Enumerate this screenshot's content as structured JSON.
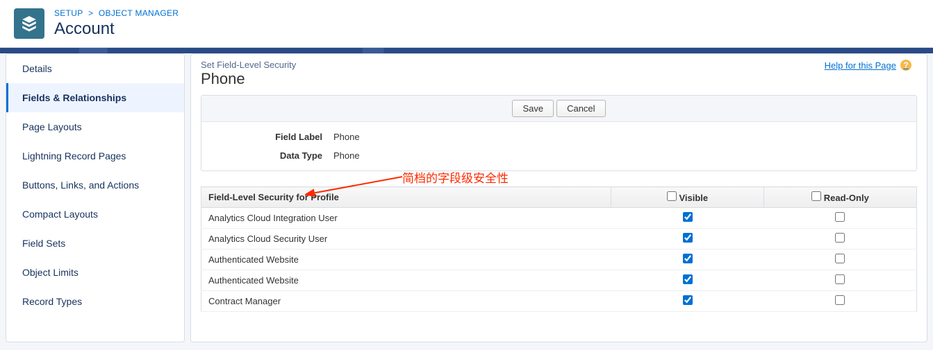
{
  "breadcrumb": {
    "setup": "SETUP",
    "sep": ">",
    "om": "OBJECT MANAGER"
  },
  "page_title": "Account",
  "help_label": "Help for this Page",
  "sidebar": {
    "items": [
      {
        "label": "Details"
      },
      {
        "label": "Fields & Relationships"
      },
      {
        "label": "Page Layouts"
      },
      {
        "label": "Lightning Record Pages"
      },
      {
        "label": "Buttons, Links, and Actions"
      },
      {
        "label": "Compact Layouts"
      },
      {
        "label": "Field Sets"
      },
      {
        "label": "Object Limits"
      },
      {
        "label": "Record Types"
      }
    ],
    "active_index": 1
  },
  "main": {
    "subtitle": "Set Field-Level Security",
    "title": "Phone",
    "buttons": {
      "save": "Save",
      "cancel": "Cancel"
    },
    "fields": {
      "label_label": "Field Label",
      "label_value": "Phone",
      "type_label": "Data Type",
      "type_value": "Phone"
    },
    "annotation": "简档的字段级安全性",
    "table": {
      "header": {
        "profile": "Field-Level Security for Profile",
        "visible": "Visible",
        "readonly": "Read-Only"
      },
      "rows": [
        {
          "profile": "Analytics Cloud Integration User",
          "visible": true,
          "readonly": false
        },
        {
          "profile": "Analytics Cloud Security User",
          "visible": true,
          "readonly": false
        },
        {
          "profile": "Authenticated Website",
          "visible": true,
          "readonly": false
        },
        {
          "profile": "Authenticated Website",
          "visible": true,
          "readonly": false
        },
        {
          "profile": "Contract Manager",
          "visible": true,
          "readonly": false
        }
      ]
    }
  }
}
